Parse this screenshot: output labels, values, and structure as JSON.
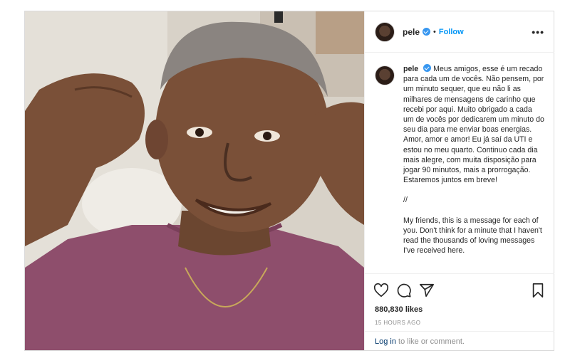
{
  "post": {
    "username": "pele",
    "separator": "•",
    "follow_label": "Follow",
    "more_icon": "more-icon",
    "caption": {
      "username": "pele",
      "portuguese": "Meus amigos, esse é um recado para cada um de vocês. Não pensem, por um minuto sequer, que eu não li as milhares de mensagens de carinho que recebi por aqui. Muito obrigado a cada um de vocês por dedicarem um minuto do seu dia para me enviar boas energias. Amor, amor e amor! Eu já saí da UTI e estou no meu quarto. Continuo cada dia mais alegre, com muita disposição para jogar 90 minutos, mais a prorrogação. Estaremos juntos em breve!",
      "divider": "//",
      "english": "My friends, this is a message for each of you. Don't think for a minute that I haven't read the thousands of loving messages I've received here."
    },
    "likes": "880,830 likes",
    "timestamp": "15 HOURS AGO",
    "comment": {
      "login_label": "Log in",
      "suffix": " to like or comment."
    },
    "icons": [
      "heart-icon",
      "comment-icon",
      "share-icon",
      "bookmark-icon"
    ],
    "colors": {
      "link_blue": "#0095f6",
      "verified_blue": "#3897f0",
      "border": "#dbdbdb",
      "muted": "#8e8e8e"
    }
  }
}
